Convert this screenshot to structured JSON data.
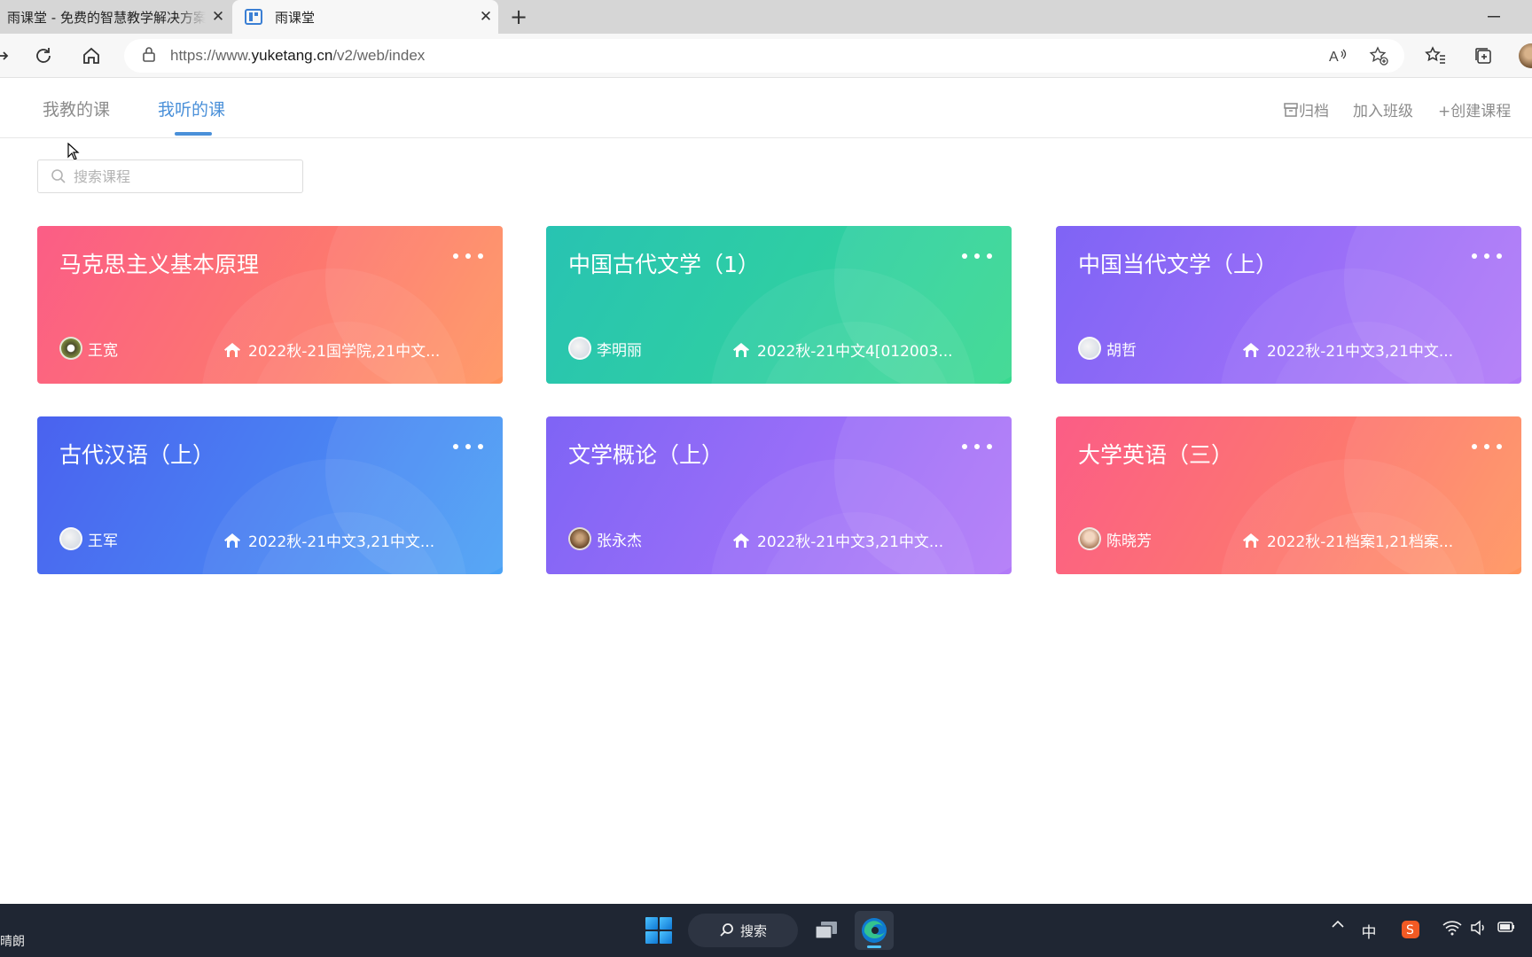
{
  "browser": {
    "tabs": [
      {
        "title": "雨课堂 - 免费的智慧教学解决方案"
      },
      {
        "title": "雨课堂"
      }
    ],
    "url_prefix": "https://www.",
    "url_domain": "yuketang.cn",
    "url_path": "/v2/web/index"
  },
  "nav": {
    "tabs": [
      {
        "label": "我教的课"
      },
      {
        "label": "我听的课"
      }
    ],
    "active_tab": 1,
    "actions": {
      "archive": "归档",
      "join_class": "加入班级",
      "create_course": "+创建课程"
    }
  },
  "search": {
    "placeholder": "搜索课程"
  },
  "courses": [
    {
      "title": "马克思主义基本原理",
      "teacher": "王宽",
      "class": "2022秋-21国学院,21中文..."
    },
    {
      "title": "中国古代文学（1）",
      "teacher": "李明丽",
      "class": "2022秋-21中文4[012003..."
    },
    {
      "title": "中国当代文学（上）",
      "teacher": "胡哲",
      "class": "2022秋-21中文3,21中文..."
    },
    {
      "title": "古代汉语（上）",
      "teacher": "王军",
      "class": "2022秋-21中文3,21中文..."
    },
    {
      "title": "文学概论（上）",
      "teacher": "张永杰",
      "class": "2022秋-21中文3,21中文..."
    },
    {
      "title": "大学英语（三）",
      "teacher": "陈晓芳",
      "class": "2022秋-21档案1,21档案..."
    }
  ],
  "taskbar": {
    "weather": "晴朗",
    "search_label": "搜索",
    "ime": "中"
  },
  "colors": {
    "accent": "#4a90d9",
    "card_red": "#fb5d86",
    "card_teal": "#28c3b2",
    "card_purple": "#9b6ff8",
    "card_blue": "#4a86f3"
  }
}
